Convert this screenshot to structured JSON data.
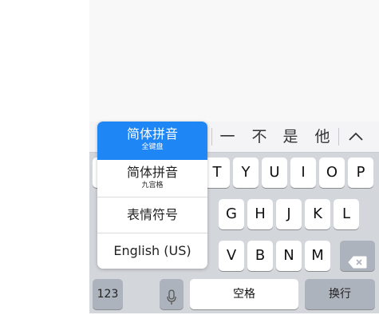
{
  "candidates": {
    "items": [
      "一",
      "不",
      "是",
      "他"
    ],
    "expand_icon": "chevron-up-icon"
  },
  "keyboard": {
    "row2": [
      "T",
      "Y",
      "U",
      "I",
      "O",
      "P"
    ],
    "row3": [
      "G",
      "H",
      "J",
      "K",
      "L"
    ],
    "row4": [
      "V",
      "B",
      "N",
      "M"
    ],
    "delete_icon": "backspace-icon",
    "numbers_key": "123",
    "mic_icon": "microphone-icon",
    "space_key": "空格",
    "return_key": "换行"
  },
  "input_menu": {
    "items": [
      {
        "label": "简体拼音",
        "sub": "全键盘",
        "selected": true
      },
      {
        "label": "简体拼音",
        "sub": "九宫格",
        "selected": false
      },
      {
        "label": "表情符号",
        "sub": "",
        "selected": false
      },
      {
        "label": "English (US)",
        "sub": "",
        "selected": false
      }
    ],
    "selected_color": "#1e86f5"
  }
}
